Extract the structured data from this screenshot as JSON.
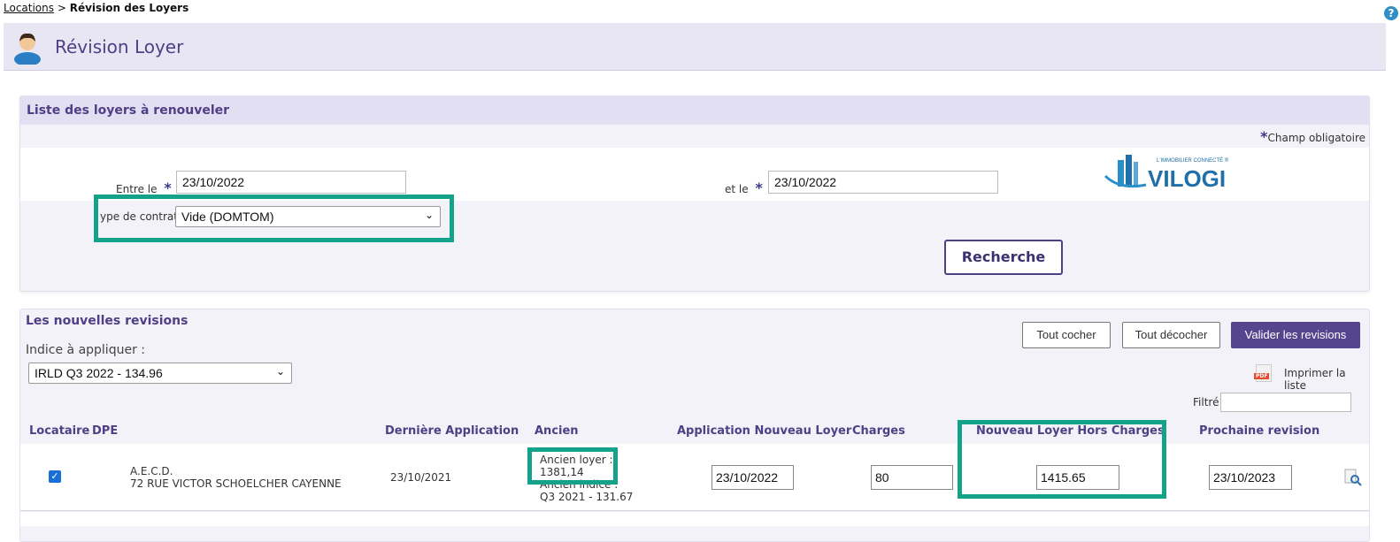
{
  "breadcrumb": {
    "link": "Locations",
    "separator": ">",
    "current": "Révision des Loyers"
  },
  "header": {
    "title": "Révision Loyer"
  },
  "search_panel": {
    "title": "Liste des loyers à renouveler",
    "required_note": "Champ obligatoire",
    "required_star": "*",
    "from_label": "Entre le",
    "from_value": "23/10/2022",
    "to_label": "et le",
    "to_value": "23/10/2022",
    "contract_label": "ype de contrat",
    "contract_value": "Vide (DOMTOM)",
    "logo_text": "VILOGI",
    "logo_tagline": "L'IMMOBILIER CONNECTÉ ®",
    "search_button": "Recherche"
  },
  "revisions_panel": {
    "title": "Les nouvelles revisions",
    "index_label": "Indice à appliquer :",
    "index_value": "IRLD Q3 2022 - 134.96",
    "check_all": "Tout cocher",
    "uncheck_all": "Tout décocher",
    "validate": "Valider les revisions",
    "print": "Imprimer la liste",
    "filter_label": "Filtré",
    "filter_value": "",
    "columns": {
      "tenant": "Locataire",
      "dpe": "DPE",
      "last_application": "Dernière Application",
      "old": "Ancien",
      "new_application": "Application Nouveau Loyer",
      "charges": "Charges",
      "new_rent": "Nouveau Loyer Hors Charges",
      "next_revision": "Prochaine revision"
    },
    "row": {
      "checked": true,
      "tenant_name": "A.E.C.D.",
      "tenant_address": "72 RUE VICTOR SCHOELCHER CAYENNE",
      "last_application": "23/10/2021",
      "old_rent_label": "Ancien loyer :",
      "old_rent_value": "1381,14",
      "old_index_label": "Ancien indice :",
      "old_index_value": "Q3 2021 - 131.67",
      "new_application": "23/10/2022",
      "charges": "80",
      "new_rent": "1415.65",
      "next_revision": "23/10/2023"
    }
  },
  "colors": {
    "accent": "#4e3f86",
    "highlight": "#14a38a",
    "header_bg": "#e9e6f4"
  }
}
